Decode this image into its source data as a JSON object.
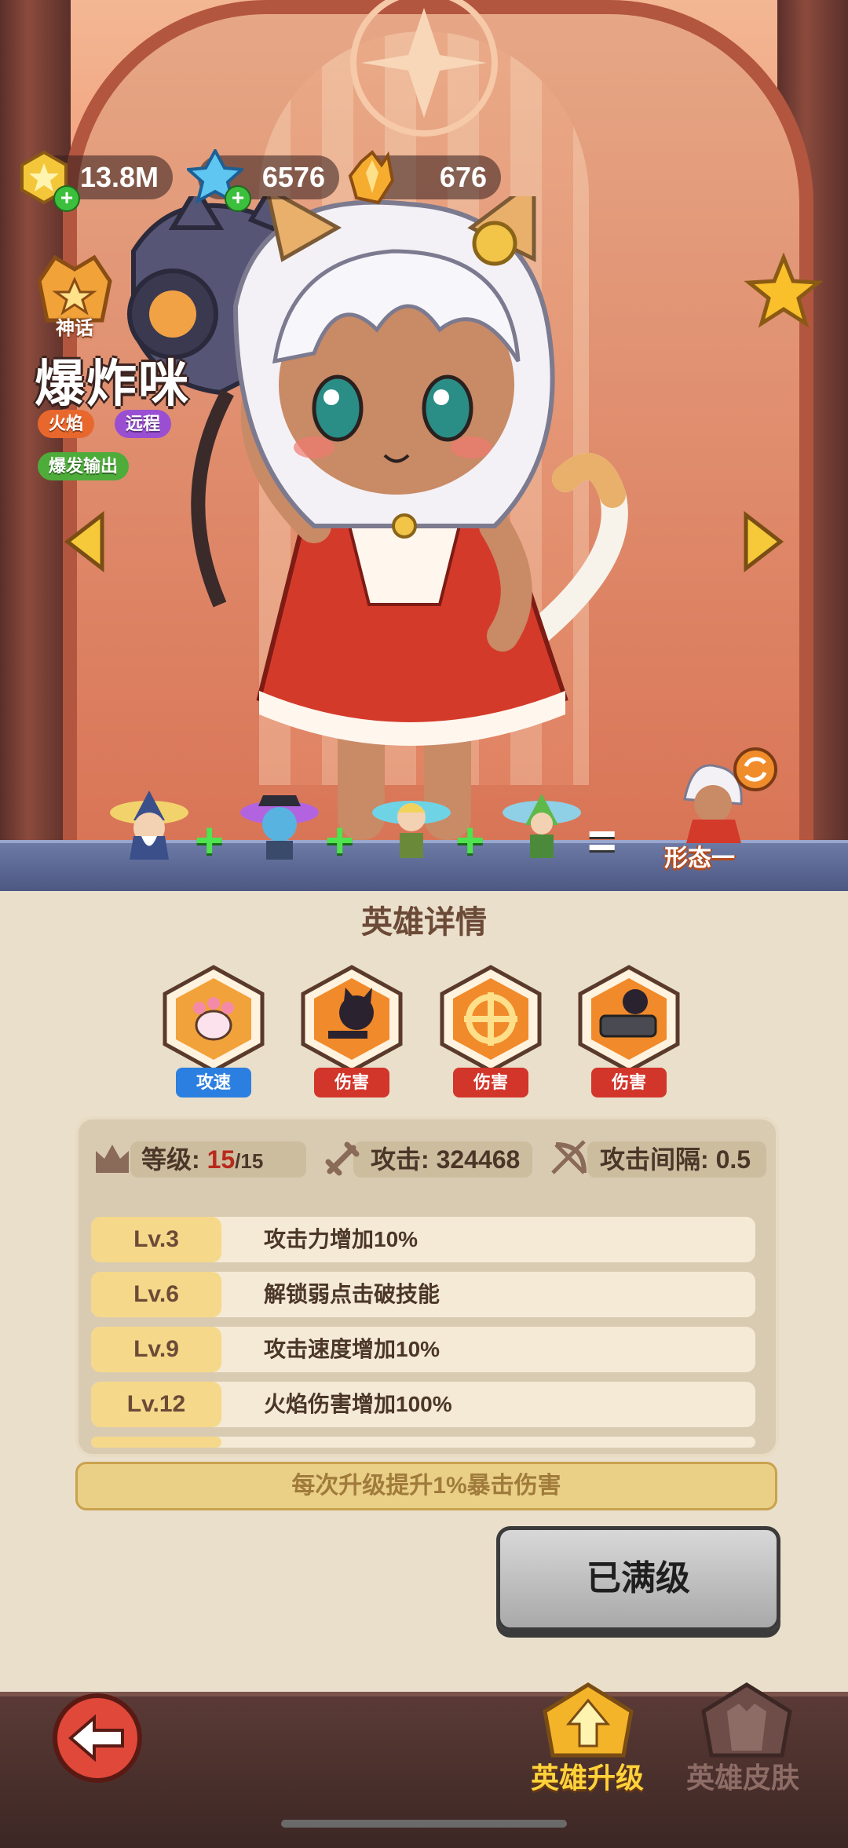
{
  "currencies": [
    {
      "icon": "gold-coin-icon",
      "value": "13.8M"
    },
    {
      "icon": "blue-crystal-icon",
      "value": "6576"
    },
    {
      "icon": "orange-crystal-icon",
      "value": "676"
    }
  ],
  "hero": {
    "rank_label": "神话",
    "name": "爆炸咪",
    "tags": [
      "火焰",
      "远程",
      "爆发输出"
    ]
  },
  "form": {
    "label": "形态一",
    "plus": "+",
    "equals": "="
  },
  "panel": {
    "title": "英雄详情",
    "skills": [
      {
        "icon": "paw-icon",
        "label": "攻速",
        "color": "#2b7fe0"
      },
      {
        "icon": "cat-dash-icon",
        "label": "伤害",
        "color": "#d2352a"
      },
      {
        "icon": "crosshair-icon",
        "label": "伤害",
        "color": "#d2352a"
      },
      {
        "icon": "gatling-cat-icon",
        "label": "伤害",
        "color": "#d2352a"
      }
    ],
    "stats": {
      "level_label": "等级:",
      "level_current": "15",
      "level_max": "/15",
      "attack_label": "攻击:",
      "attack_value": "324468",
      "interval_label": "攻击间隔:",
      "interval_value": "0.5"
    },
    "level_rows": [
      {
        "lv": "Lv.3",
        "text": "攻击力增加10%"
      },
      {
        "lv": "Lv.6",
        "text": "解锁弱点击破技能"
      },
      {
        "lv": "Lv.9",
        "text": "攻击速度增加10%"
      },
      {
        "lv": "Lv.12",
        "text": "火焰伤害增加100%"
      }
    ],
    "bonus_text": "每次升级提升1%暴击伤害",
    "max_button": "已满级"
  },
  "bottom_tabs": {
    "upgrade": "英雄升级",
    "skin": "英雄皮肤",
    "active_color": "#ffd23a",
    "inactive_color": "#8e6c66"
  }
}
